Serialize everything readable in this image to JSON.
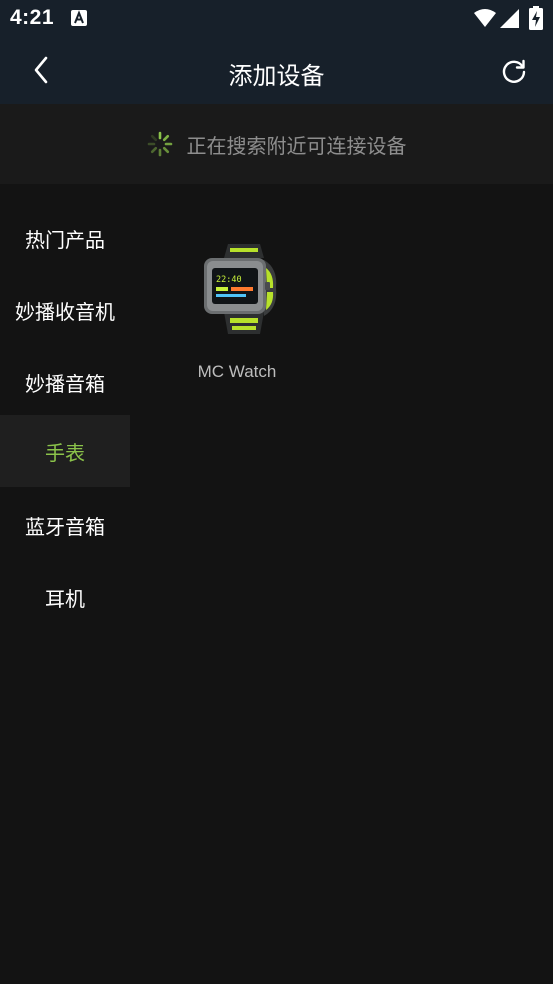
{
  "status_bar": {
    "time": "4:21",
    "icons": [
      "notification-a-icon",
      "wifi-icon",
      "signal-icon",
      "battery-charging-icon"
    ]
  },
  "header": {
    "title": "添加设备",
    "back_icon": "chevron-left-icon",
    "refresh_icon": "refresh-icon"
  },
  "search": {
    "status_text": "正在搜索附近可连接设备",
    "spinner_icon": "loading-spinner-icon"
  },
  "categories": [
    {
      "label": "热门产品",
      "selected": false
    },
    {
      "label": "妙播收音机",
      "selected": false
    },
    {
      "label": "妙播音箱",
      "selected": false
    },
    {
      "label": "手表",
      "selected": true
    },
    {
      "label": "蓝牙音箱",
      "selected": false
    },
    {
      "label": "耳机",
      "selected": false
    }
  ],
  "devices": [
    {
      "name": "MC Watch",
      "screen_text": "22:40",
      "icon": "smartwatch-image"
    }
  ],
  "colors": {
    "accent": "#8bc34a",
    "header_bg": "#17202a",
    "page_bg": "#131313",
    "banner_bg": "#1a1a1a",
    "selected_bg": "#1f1f1f",
    "muted_text": "#8e8e8e"
  }
}
